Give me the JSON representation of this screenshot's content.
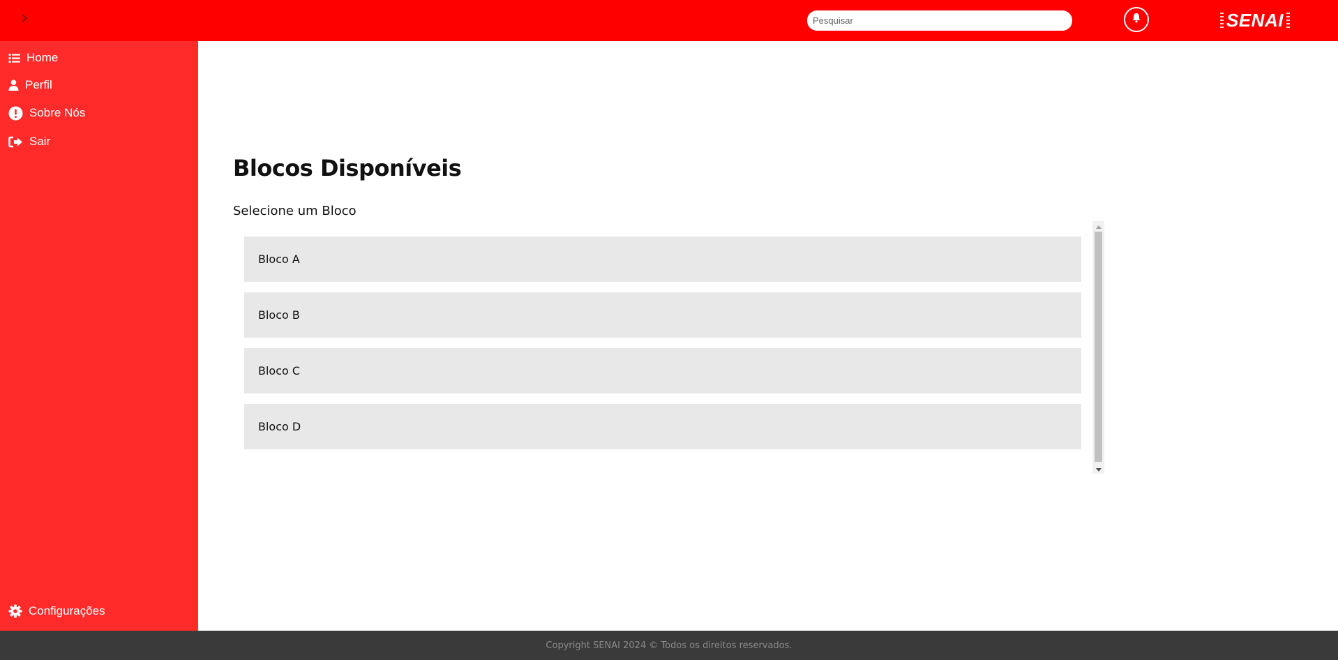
{
  "topbar": {
    "toggle_icon": "chevron-right-icon",
    "search": {
      "placeholder": "Pesquisar",
      "value": ""
    },
    "notification_icon": "bell-icon",
    "logo_text": "SENAI",
    "background_color": "#ff0000"
  },
  "sidebar": {
    "background_color": "#ff2b2b",
    "items": [
      {
        "label": "Home",
        "icon": "list-icon"
      },
      {
        "label": "Perfil",
        "icon": "user-icon"
      },
      {
        "label": "Sobre Nós",
        "icon": "exclamation-circle-icon"
      },
      {
        "label": "Sair",
        "icon": "sign-out-icon"
      }
    ],
    "footer_item": {
      "label": "Configurações",
      "icon": "gear-icon"
    }
  },
  "main": {
    "title": "Blocos Disponíveis",
    "subtitle": "Selecione um Bloco",
    "blocks": [
      {
        "label": "Bloco A"
      },
      {
        "label": "Bloco B"
      },
      {
        "label": "Bloco C"
      },
      {
        "label": "Bloco D"
      }
    ]
  },
  "footer": {
    "text": "Copyright SENAI 2024 © Todos os direitos reservados.",
    "background_color": "#3a3a3a"
  }
}
